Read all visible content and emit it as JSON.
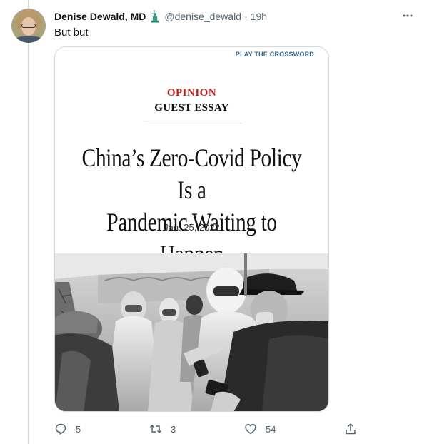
{
  "tweet": {
    "author_name": "Denise Dewald, MD",
    "author_badge_icon": "statue-of-liberty-icon",
    "handle": "@denise_dewald",
    "separator": "·",
    "timestamp": "19h",
    "more_icon": "more-horizontal-icon",
    "text": "But but"
  },
  "card": {
    "crossword_link": "PLAY THE CROSSWORD",
    "section": "OPINION",
    "subsection": "GUEST ESSAY",
    "headline_line1": "China’s Zero-Covid Policy Is a",
    "headline_line2": "Pandemic Waiting to Happen",
    "date": "Jan. 25, 2022"
  },
  "actions": {
    "reply_icon": "reply-icon",
    "reply_count": "5",
    "retweet_icon": "retweet-icon",
    "retweet_count": "3",
    "like_icon": "heart-icon",
    "like_count": "54",
    "share_icon": "share-icon"
  },
  "colors": {
    "opinion_red": "#c11b17",
    "link_blue": "#326891",
    "muted_gray": "#536471",
    "border": "#cfd9de"
  }
}
